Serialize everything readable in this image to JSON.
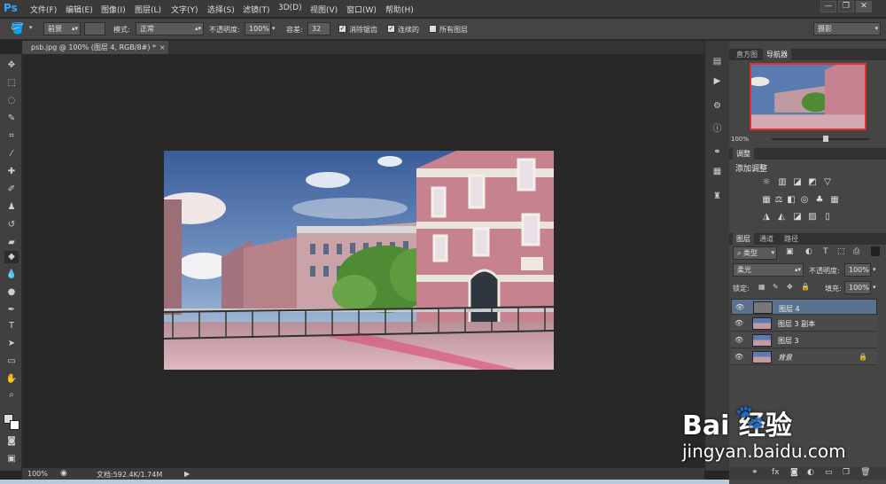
{
  "app": {
    "logo": "Ps"
  },
  "menu": [
    "文件(F)",
    "编辑(E)",
    "图像(I)",
    "图层(L)",
    "文字(Y)",
    "选择(S)",
    "滤镜(T)",
    "3D(D)",
    "视图(V)",
    "窗口(W)",
    "帮助(H)"
  ],
  "window_controls": {
    "minimize": "—",
    "restore": "❐",
    "close": "✕"
  },
  "options": {
    "fill_source": "前景",
    "mode_label": "模式:",
    "mode_value": "正常",
    "opacity_label": "不透明度:",
    "opacity_value": "100%",
    "tolerance_label": "容差:",
    "tolerance_value": "32",
    "antialias_label": "消除锯齿",
    "antialias_checked": true,
    "contiguous_label": "连续的",
    "contiguous_checked": true,
    "all_layers_label": "所有图层",
    "all_layers_checked": false,
    "workspace": "摄影"
  },
  "document_tab": {
    "title": "psb.jpg @ 100% (图层 4, RGB/8#) *",
    "close": "×"
  },
  "status": {
    "zoom": "100%",
    "doc_size": "文档:592.4K/1.74M"
  },
  "navigator": {
    "tabs": [
      "直方图",
      "导航器"
    ],
    "active_tab": "导航器",
    "zoom": "100%",
    "slider_fraction": 0.55
  },
  "adjustments": {
    "tab": "调整",
    "add_label": "添加调整"
  },
  "layers_panel": {
    "tabs": [
      "图层",
      "通道",
      "路径"
    ],
    "active_tab": "图层",
    "filter_kind": "类型",
    "blend_mode": "柔光",
    "opacity_label": "不透明度:",
    "opacity_value": "100%",
    "lock_label": "锁定:",
    "fill_label": "填充:",
    "fill_value": "100%",
    "layers": [
      {
        "name": "图层 4",
        "selected": true,
        "thumb": "gray"
      },
      {
        "name": "图层 3 副本",
        "selected": false,
        "thumb": "photo"
      },
      {
        "name": "图层 3",
        "selected": false,
        "thumb": "photo"
      },
      {
        "name": "背景",
        "selected": false,
        "thumb": "photo",
        "locked": true
      }
    ],
    "footer_icons": [
      "link-icon",
      "fx-icon",
      "mask-icon",
      "adjustment-icon",
      "folder-icon",
      "new-layer-icon",
      "trash-icon"
    ]
  },
  "watermark": {
    "brand": "Bai 经验",
    "url": "jingyan.baidu.com"
  },
  "colors": {
    "accent": "#31a8ff",
    "selected_layer": "#5b7190",
    "navigator_frame": "#e03030"
  }
}
